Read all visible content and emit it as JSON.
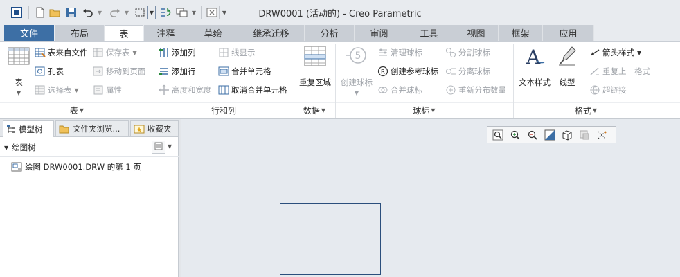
{
  "window": {
    "title": "DRW0001 (活动的) - Creo Parametric"
  },
  "quick_access": {
    "icons": [
      "window-icon",
      "new-icon",
      "open-icon",
      "save-icon",
      "undo-icon",
      "redo-icon",
      "select-box-icon",
      "regenerate-icon",
      "windows-icon",
      "close-window-icon",
      "customize-icon"
    ]
  },
  "tabs": [
    {
      "label": "文件"
    },
    {
      "label": "布局"
    },
    {
      "label": "表"
    },
    {
      "label": "注释"
    },
    {
      "label": "草绘"
    },
    {
      "label": "继承迁移"
    },
    {
      "label": "分析"
    },
    {
      "label": "审阅"
    },
    {
      "label": "工具"
    },
    {
      "label": "视图"
    },
    {
      "label": "框架"
    },
    {
      "label": "应用"
    }
  ],
  "ribbon": {
    "table_group": {
      "big_label": "表",
      "table_from_file": "表来自文件",
      "save_table": "保存表",
      "hole_table": "孔表",
      "move_to_page": "移动到页面",
      "select_table": "选择表",
      "properties": "属性",
      "group_label": "表"
    },
    "rows_cols_group": {
      "add_column": "添加列",
      "line_display": "线显示",
      "add_row": "添加行",
      "merge_cells": "合并单元格",
      "height_width": "高度和宽度",
      "unmerge_cells": "取消合并单元格",
      "group_label": "行和列"
    },
    "data_group": {
      "repeat_region": "重复区域",
      "group_label": "数据"
    },
    "balloon_group": {
      "create_balloon": "创建球标",
      "clean_balloons": "清理球标",
      "split_balloons": "分割球标",
      "create_ref_balloon": "创建参考球标",
      "detach_balloons": "分离球标",
      "merge_balloons": "合并球标",
      "redistribute_qty": "重新分布数量",
      "group_label": "球标"
    },
    "format_group": {
      "text_style": "文本样式",
      "line_style": "线型",
      "arrow_style": "箭头样式",
      "repeat_last_format": "重复上一格式",
      "hyperlink": "超链接",
      "group_label": "格式"
    }
  },
  "navigator": {
    "tabs": [
      {
        "label": "模型树"
      },
      {
        "label": "文件夹浏览..."
      },
      {
        "label": "收藏夹"
      }
    ],
    "tree_header": "绘图树",
    "items": [
      {
        "label": "绘图 DRW0001.DRW 的第 1 页"
      }
    ]
  },
  "view_toolbar": {
    "icons": [
      "refit-icon",
      "zoom-in-icon",
      "zoom-out-icon",
      "repaint-icon",
      "display-style-icon",
      "hidden-toggle-icon",
      "datum-display-icon"
    ]
  },
  "colors": {
    "file_tab": "#3d6fa5",
    "sheet_border": "#2b4f7c",
    "canvas": "#e6eaef"
  }
}
